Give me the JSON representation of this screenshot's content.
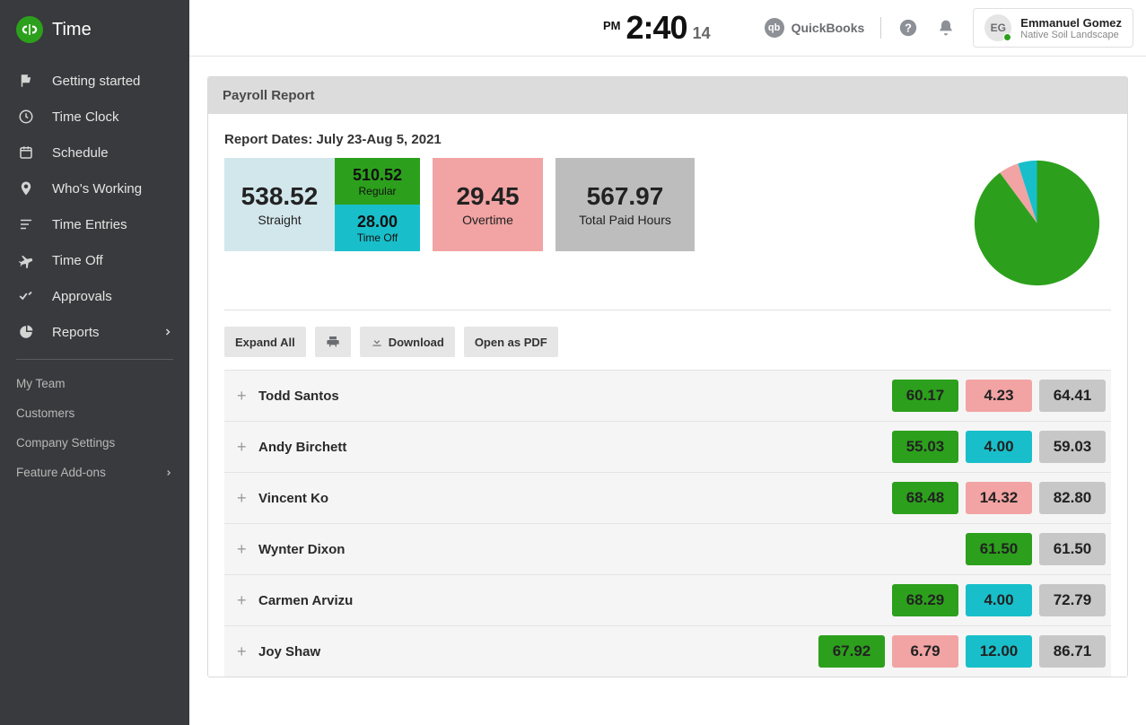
{
  "app": {
    "name": "Time"
  },
  "nav": {
    "items": [
      {
        "label": "Getting started"
      },
      {
        "label": "Time Clock"
      },
      {
        "label": "Schedule"
      },
      {
        "label": "Who's Working"
      },
      {
        "label": "Time Entries"
      },
      {
        "label": "Time Off"
      },
      {
        "label": "Approvals"
      },
      {
        "label": "Reports"
      }
    ],
    "sub": [
      {
        "label": "My Team"
      },
      {
        "label": "Customers"
      },
      {
        "label": "Company Settings"
      },
      {
        "label": "Feature Add-ons"
      }
    ]
  },
  "clock": {
    "ampm": "PM",
    "time": "2:40",
    "seconds": "14"
  },
  "topbar": {
    "quickbooks_label": "QuickBooks"
  },
  "user": {
    "initials": "EG",
    "name": "Emmanuel Gomez",
    "company": "Native Soil Landscape"
  },
  "report": {
    "panel_title": "Payroll Report",
    "dates_label": "Report Dates:",
    "dates_range": "July 23-Aug 5, 2021",
    "tiles": {
      "straight": {
        "value": "538.52",
        "label": "Straight"
      },
      "regular": {
        "value": "510.52",
        "label": "Regular"
      },
      "timeoff": {
        "value": "28.00",
        "label": "Time Off"
      },
      "overtime": {
        "value": "29.45",
        "label": "Overtime"
      },
      "total": {
        "value": "567.97",
        "label": "Total Paid Hours"
      }
    },
    "actions": {
      "expand": "Expand All",
      "download": "Download",
      "pdf": "Open as PDF"
    },
    "rows": [
      {
        "name": "Todd Santos",
        "green": "60.17",
        "pink": "4.23",
        "teal": null,
        "grey": "64.41"
      },
      {
        "name": "Andy Birchett",
        "green": "55.03",
        "pink": null,
        "teal": "4.00",
        "grey": "59.03"
      },
      {
        "name": "Vincent Ko",
        "green": "68.48",
        "pink": "14.32",
        "teal": null,
        "grey": "82.80"
      },
      {
        "name": "Wynter Dixon",
        "green": "61.50",
        "pink": null,
        "teal": null,
        "grey": "61.50"
      },
      {
        "name": "Carmen Arvizu",
        "green": "68.29",
        "pink": null,
        "teal": "4.00",
        "grey": "72.79"
      },
      {
        "name": "Joy Shaw",
        "green": "67.92",
        "pink": "6.79",
        "teal": "12.00",
        "grey": "86.71"
      }
    ]
  },
  "chart_data": {
    "type": "pie",
    "title": "",
    "series": [
      {
        "name": "Regular",
        "value": 510.52,
        "color": "#2ca01c"
      },
      {
        "name": "Overtime",
        "value": 29.45,
        "color": "#f2a3a3"
      },
      {
        "name": "Time Off",
        "value": 28.0,
        "color": "#18bfca"
      }
    ]
  }
}
